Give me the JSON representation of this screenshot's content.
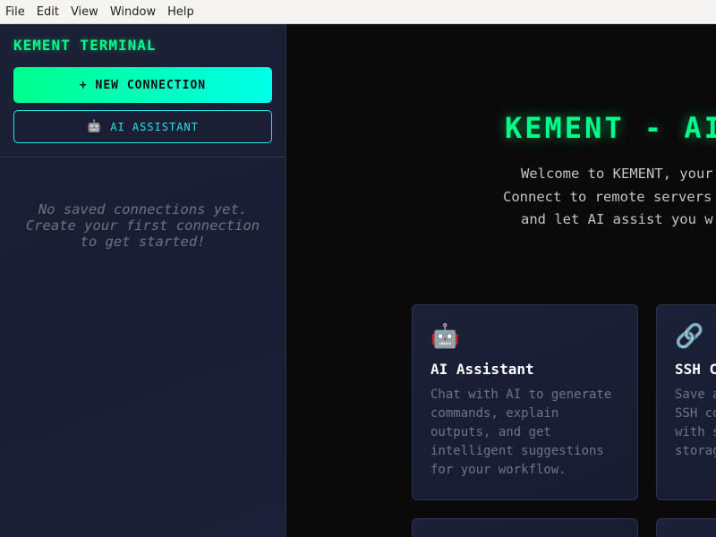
{
  "menu": [
    "File",
    "Edit",
    "View",
    "Window",
    "Help"
  ],
  "sidebar": {
    "brand": "KEMENT TERMINAL",
    "new_connection_label": "+ NEW CONNECTION",
    "ai_assistant_icon": "robot-icon",
    "ai_assistant_label": "AI ASSISTANT",
    "empty_message": "No saved connections yet. Create your first connection to get started!"
  },
  "main": {
    "title": "KEMENT - AI",
    "welcome_lines": [
      "Welcome to KEMENT, your",
      "Connect to remote servers",
      "and let AI assist you w"
    ],
    "cards": [
      {
        "icon": "robot-icon",
        "title": "AI Assistant",
        "description": "Chat with AI to generate commands, explain outputs, and get intelligent suggestions for your workflow."
      },
      {
        "icon": "link-icon",
        "title": "SSH C",
        "description": "Save a SSH co with s storag"
      }
    ]
  },
  "colors": {
    "accent_green": "#00ff88",
    "accent_cyan": "#1ee6e6",
    "background": "#0a0a0a",
    "sidebar_bg": "#1c2036"
  }
}
